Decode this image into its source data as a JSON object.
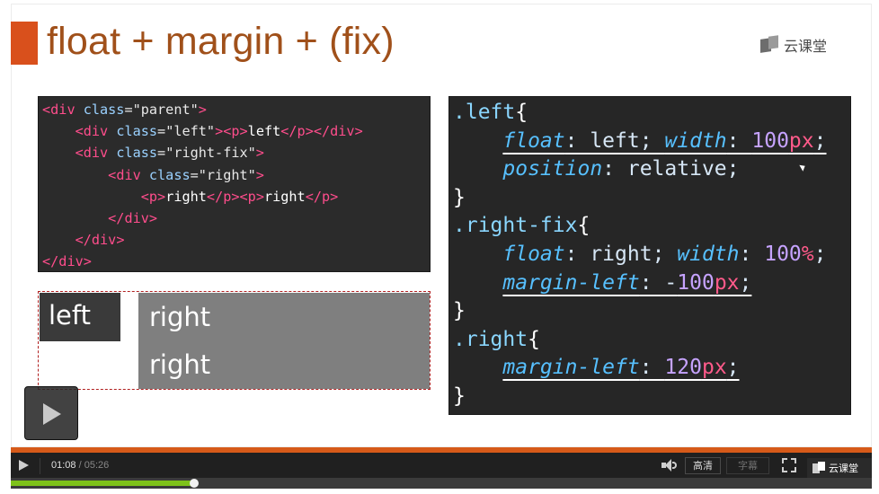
{
  "slide": {
    "title": "float + margin + (fix)",
    "brand": "云课堂"
  },
  "html_code": {
    "lines": [
      {
        "parts": [
          {
            "c": "t-tag",
            "t": "<"
          },
          {
            "c": "t-tag",
            "t": "div"
          },
          {
            "c": "t-attr",
            "t": " class"
          },
          {
            "c": "t-str",
            "t": "=\"parent\""
          },
          {
            "c": "t-tag",
            "t": ">"
          }
        ]
      },
      {
        "parts": [
          {
            "c": "t-str",
            "t": "    "
          },
          {
            "c": "t-tag",
            "t": "<"
          },
          {
            "c": "t-tag",
            "t": "div"
          },
          {
            "c": "t-attr",
            "t": " class"
          },
          {
            "c": "t-str",
            "t": "=\"left\""
          },
          {
            "c": "t-tag",
            "t": "><"
          },
          {
            "c": "t-tag",
            "t": "p"
          },
          {
            "c": "t-tag",
            "t": ">"
          },
          {
            "c": "t-txt",
            "t": "left"
          },
          {
            "c": "t-tag",
            "t": "</"
          },
          {
            "c": "t-tag",
            "t": "p"
          },
          {
            "c": "t-tag",
            "t": "></"
          },
          {
            "c": "t-tag",
            "t": "div"
          },
          {
            "c": "t-tag",
            "t": ">"
          }
        ]
      },
      {
        "parts": [
          {
            "c": "t-str",
            "t": "    "
          },
          {
            "c": "t-tag",
            "t": "<"
          },
          {
            "c": "t-tag",
            "t": "div"
          },
          {
            "c": "t-attr",
            "t": " class"
          },
          {
            "c": "t-str",
            "t": "=\"right-fix\""
          },
          {
            "c": "t-tag",
            "t": ">"
          }
        ]
      },
      {
        "parts": [
          {
            "c": "t-str",
            "t": "        "
          },
          {
            "c": "t-tag",
            "t": "<"
          },
          {
            "c": "t-tag",
            "t": "div"
          },
          {
            "c": "t-attr",
            "t": " class"
          },
          {
            "c": "t-str",
            "t": "=\"right\""
          },
          {
            "c": "t-tag",
            "t": ">"
          }
        ]
      },
      {
        "parts": [
          {
            "c": "t-str",
            "t": "            "
          },
          {
            "c": "t-tag",
            "t": "<"
          },
          {
            "c": "t-tag",
            "t": "p"
          },
          {
            "c": "t-tag",
            "t": ">"
          },
          {
            "c": "t-txt",
            "t": "right"
          },
          {
            "c": "t-tag",
            "t": "</"
          },
          {
            "c": "t-tag",
            "t": "p"
          },
          {
            "c": "t-tag",
            "t": "><"
          },
          {
            "c": "t-tag",
            "t": "p"
          },
          {
            "c": "t-tag",
            "t": ">"
          },
          {
            "c": "t-txt",
            "t": "right"
          },
          {
            "c": "t-tag",
            "t": "</"
          },
          {
            "c": "t-tag",
            "t": "p"
          },
          {
            "c": "t-tag",
            "t": ">"
          }
        ]
      },
      {
        "parts": [
          {
            "c": "t-str",
            "t": "        "
          },
          {
            "c": "t-tag",
            "t": "</"
          },
          {
            "c": "t-tag",
            "t": "div"
          },
          {
            "c": "t-tag",
            "t": ">"
          }
        ]
      },
      {
        "parts": [
          {
            "c": "t-str",
            "t": "    "
          },
          {
            "c": "t-tag",
            "t": "</"
          },
          {
            "c": "t-tag",
            "t": "div"
          },
          {
            "c": "t-tag",
            "t": ">"
          }
        ]
      },
      {
        "parts": [
          {
            "c": "t-tag",
            "t": "</"
          },
          {
            "c": "t-tag",
            "t": "div"
          },
          {
            "c": "t-tag",
            "t": ">"
          }
        ]
      }
    ]
  },
  "demo": {
    "left_text": "left",
    "right_text_1": "right",
    "right_text_2": "right"
  },
  "css_code": {
    "lines": [
      {
        "parts": [
          {
            "c": "c-sel",
            "t": ".left"
          },
          {
            "c": "c-brace",
            "t": "{"
          }
        ]
      },
      {
        "parts": [
          {
            "c": "c-val",
            "t": "    "
          },
          {
            "c": "c-prop u",
            "t": "float"
          },
          {
            "c": "c-val u",
            "t": ": left; "
          },
          {
            "c": "c-prop u",
            "t": "width"
          },
          {
            "c": "c-val u",
            "t": ": "
          },
          {
            "c": "c-num u",
            "t": "100"
          },
          {
            "c": "c-unit u",
            "t": "px"
          },
          {
            "c": "c-val u",
            "t": ";"
          }
        ]
      },
      {
        "parts": [
          {
            "c": "c-val",
            "t": "    "
          },
          {
            "c": "c-prop",
            "t": "position"
          },
          {
            "c": "c-val",
            "t": ": relative;"
          }
        ]
      },
      {
        "parts": [
          {
            "c": "c-brace",
            "t": "}"
          }
        ]
      },
      {
        "parts": [
          {
            "c": "c-sel",
            "t": ".right-fix"
          },
          {
            "c": "c-brace",
            "t": "{"
          }
        ]
      },
      {
        "parts": [
          {
            "c": "c-val",
            "t": "    "
          },
          {
            "c": "c-prop",
            "t": "float"
          },
          {
            "c": "c-val",
            "t": ": right; "
          },
          {
            "c": "c-prop",
            "t": "width"
          },
          {
            "c": "c-val",
            "t": ": "
          },
          {
            "c": "c-num",
            "t": "100"
          },
          {
            "c": "c-unit",
            "t": "%"
          },
          {
            "c": "c-val",
            "t": ";"
          }
        ]
      },
      {
        "parts": [
          {
            "c": "c-val",
            "t": "    "
          },
          {
            "c": "c-prop u",
            "t": "margin-left"
          },
          {
            "c": "c-val u",
            "t": ": -"
          },
          {
            "c": "c-num u",
            "t": "100"
          },
          {
            "c": "c-unit u",
            "t": "px"
          },
          {
            "c": "c-val u",
            "t": ";"
          }
        ]
      },
      {
        "parts": [
          {
            "c": "c-brace",
            "t": "}"
          }
        ]
      },
      {
        "parts": [
          {
            "c": "c-sel",
            "t": ".right"
          },
          {
            "c": "c-brace",
            "t": "{"
          }
        ]
      },
      {
        "parts": [
          {
            "c": "c-val",
            "t": "    "
          },
          {
            "c": "c-prop u",
            "t": "margin-left"
          },
          {
            "c": "c-val u",
            "t": ": "
          },
          {
            "c": "c-num u",
            "t": "120"
          },
          {
            "c": "c-unit u",
            "t": "px"
          },
          {
            "c": "c-val u",
            "t": ";"
          }
        ]
      },
      {
        "parts": [
          {
            "c": "c-brace",
            "t": "}"
          }
        ]
      }
    ]
  },
  "player": {
    "current_time": "01:08",
    "total_time": "/ 05:26",
    "quality_label": "高清",
    "subtitle_label": "字幕",
    "brand_label": "云课堂",
    "progress_fraction": 0.2128
  },
  "colors": {
    "accent": "#d65a19",
    "progress": "#7ec21a",
    "title": "#a0501a"
  }
}
